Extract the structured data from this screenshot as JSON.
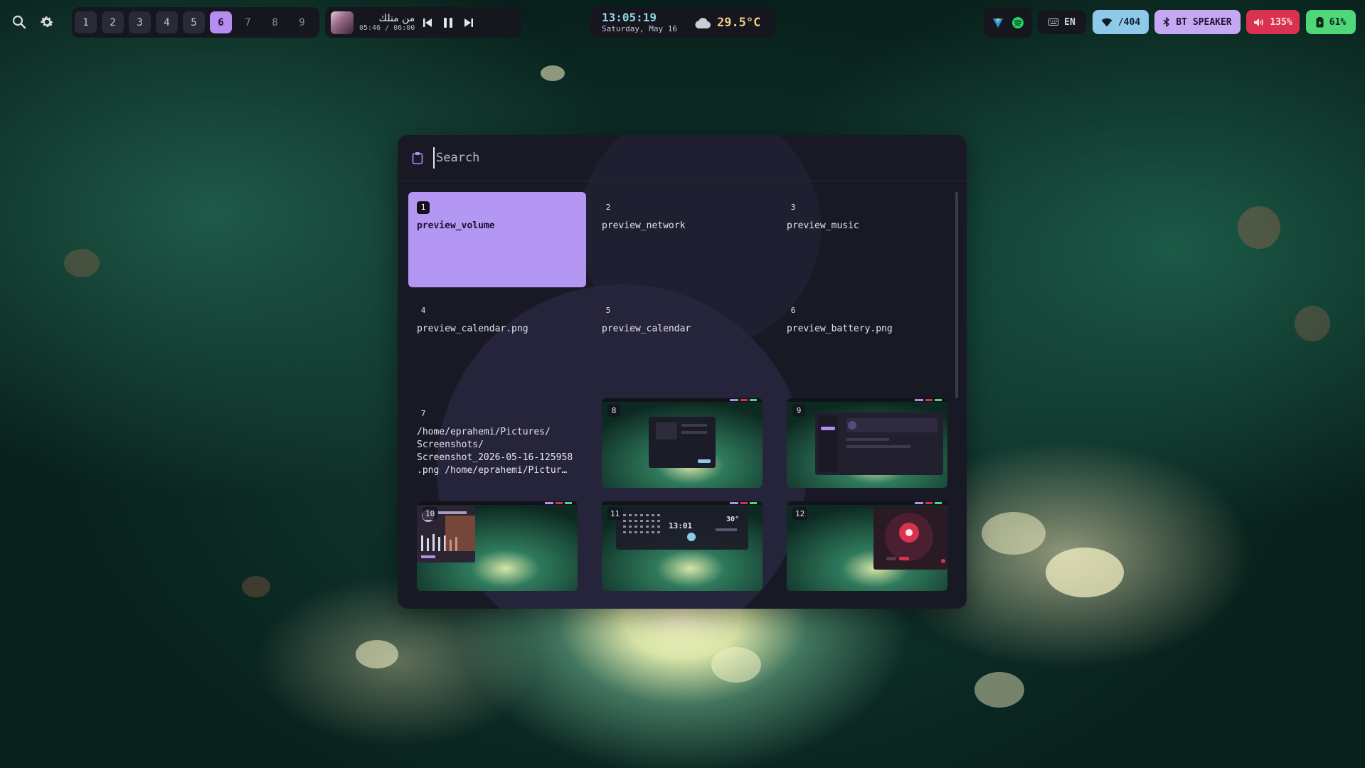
{
  "topbar": {
    "workspaces": [
      {
        "label": "1",
        "state": "occupied"
      },
      {
        "label": "2",
        "state": "occupied"
      },
      {
        "label": "3",
        "state": "occupied"
      },
      {
        "label": "4",
        "state": "occupied"
      },
      {
        "label": "5",
        "state": "occupied"
      },
      {
        "label": "6",
        "state": "active"
      },
      {
        "label": "7",
        "state": "empty"
      },
      {
        "label": "8",
        "state": "empty"
      },
      {
        "label": "9",
        "state": "empty"
      }
    ],
    "media": {
      "title": "من منلك",
      "time": "05:46 / 06:00"
    },
    "clock": {
      "time": "13:05:19",
      "date": "Saturday, May 16"
    },
    "weather": {
      "temp": "29.5°C",
      "icon": "cloud-icon"
    },
    "tray_icons": [
      "vpn-icon",
      "spotify-icon"
    ],
    "status": {
      "keyboard": "EN",
      "network": "/404",
      "bluetooth": "BT SPEAKER",
      "volume": "135%",
      "battery": "61%"
    }
  },
  "colors": {
    "accent": "#b58cf0",
    "selected_tile": "#b497f2",
    "network_chip": "#8ec9ea",
    "bluetooth_chip": "#c6a8f2",
    "volume_chip": "#d9324e",
    "battery_chip": "#4fd87a",
    "launcher_bg": "#191926",
    "bar_bg": "#16161f"
  },
  "launcher": {
    "search": {
      "placeholder": "Search",
      "value": "",
      "icon": "clipboard-icon"
    },
    "items": [
      {
        "num": "1",
        "label": "preview_volume",
        "kind": "text",
        "selected": true
      },
      {
        "num": "2",
        "label": "preview_network",
        "kind": "text",
        "selected": false
      },
      {
        "num": "3",
        "label": "preview_music",
        "kind": "text",
        "selected": false
      },
      {
        "num": "4",
        "label": "preview_calendar.png",
        "kind": "text",
        "selected": false
      },
      {
        "num": "5",
        "label": "preview_calendar",
        "kind": "text",
        "selected": false
      },
      {
        "num": "6",
        "label": "preview_battery.png",
        "kind": "text",
        "selected": false
      },
      {
        "num": "7",
        "label": "/home/eprahemi/Pictures/\nScreenshots/\nScreenshot_2026-05-16-125958\n.png /home/eprahemi/Pictur…",
        "kind": "text",
        "selected": false
      },
      {
        "num": "8",
        "label": "",
        "kind": "image",
        "selected": false
      },
      {
        "num": "9",
        "label": "",
        "kind": "image",
        "selected": false
      },
      {
        "num": "10",
        "label": "",
        "kind": "image",
        "selected": false
      },
      {
        "num": "11",
        "label": "",
        "kind": "image",
        "selected": false
      },
      {
        "num": "12",
        "label": "",
        "kind": "image",
        "selected": false
      }
    ],
    "thumb_texts": {
      "clock": "13:01",
      "temp": "30°"
    }
  }
}
